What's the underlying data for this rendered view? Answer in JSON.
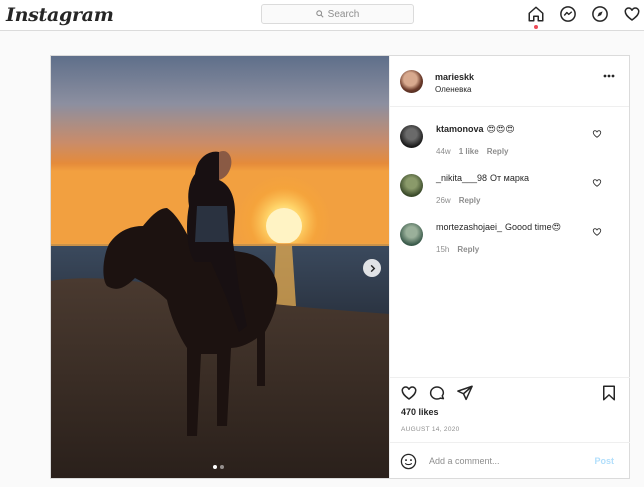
{
  "nav": {
    "logo": "Instagram",
    "search_placeholder": "Search",
    "icons": [
      "home-icon",
      "messenger-icon",
      "explore-icon",
      "heart-icon"
    ]
  },
  "post": {
    "username": "marieskk",
    "location": "Оленевка",
    "carousel": {
      "current": 1,
      "total": 2
    },
    "comments": [
      {
        "user": "ktamonova",
        "text": "😍😍😍",
        "age": "44w",
        "likes": "1 like",
        "reply": "Reply"
      },
      {
        "user": "_nikita___98",
        "text": "От марка",
        "age": "26w",
        "likes": "",
        "reply": "Reply"
      },
      {
        "user": "mortezashojaei_",
        "text": "Goood time😍",
        "age": "15h",
        "likes": "",
        "reply": "Reply"
      }
    ],
    "likes_count": "470 likes",
    "date": "AUGUST 14, 2020",
    "add_comment_placeholder": "Add a comment...",
    "post_button": "Post"
  },
  "colors": {
    "accent": "#0095f6",
    "post_disabled": "#b2dffc",
    "notification_dot": "#ed4956"
  }
}
